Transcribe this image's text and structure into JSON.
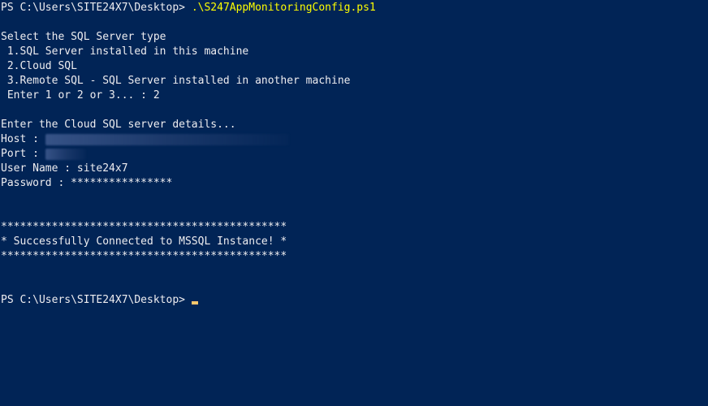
{
  "console": {
    "prompt_path": "PS C:\\Users\\SITE24X7\\Desktop>",
    "command": ".\\S247AppMonitoringConfig.ps1",
    "select_heading": "Select the SQL Server type",
    "options": [
      " 1.SQL Server installed in this machine",
      " 2.Cloud SQL",
      " 3.Remote SQL - SQL Server installed in another machine"
    ],
    "choice_prompt": " Enter 1 or 2 or 3... : 2",
    "details_heading": "Enter the Cloud SQL server details...",
    "host_label": "Host :",
    "port_label": "Port :",
    "username_line": "User Name : site24x7",
    "password_line": "Password : ****************",
    "banner_border": "*********************************************",
    "success_message": "* Successfully Connected to MSSQL Instance! *",
    "final_prompt": "PS C:\\Users\\SITE24X7\\Desktop>"
  },
  "colors": {
    "background": "#012456",
    "text": "#eeedf0",
    "command": "#fefe00",
    "cursor": "#fec76d"
  }
}
